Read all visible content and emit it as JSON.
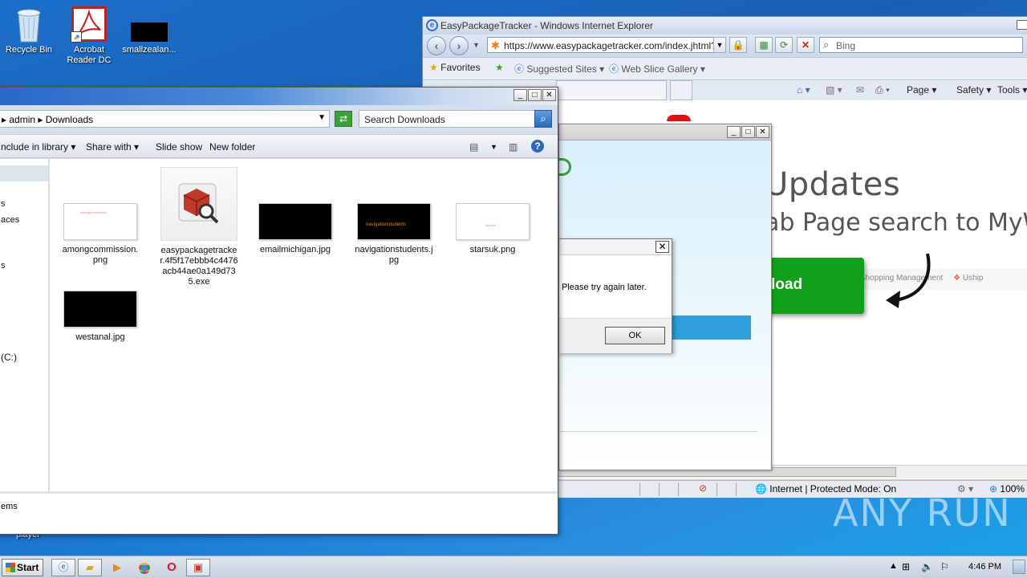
{
  "desktop": {
    "icons": [
      {
        "label": "Recycle Bin",
        "icon": "recycle-bin-icon"
      },
      {
        "label": "Acrobat Reader DC",
        "icon": "acrobat-icon"
      },
      {
        "label": "smallzealan...",
        "icon": "image-file-icon"
      }
    ],
    "partial_label": "player",
    "watermark": "ANY RUN"
  },
  "ie": {
    "title": "EasyPackageTracker - Windows Internet Explorer",
    "address": "https://www.easypackagetracker.com/index.jhtml?pa",
    "search_placeholder": "Bing",
    "favorites": "Favorites",
    "suggested_sites": "Suggested Sites",
    "web_slice_gallery": "Web Slice Gallery",
    "cmd": {
      "page": "Page",
      "safety": "Safety",
      "tools": "Tools"
    },
    "content": {
      "heading": "Updates",
      "subheading": "ab Page search to MyW",
      "download_partial": "load",
      "strip_text": "ge/Shopping Management",
      "strip_uship": "Uship"
    },
    "status": {
      "zone": "Internet | Protected Mode: On",
      "zoom": "100%"
    }
  },
  "error_dialog": {
    "message": "Please try again later.",
    "ok": "OK"
  },
  "explorer": {
    "breadcrumb": {
      "user": "admin",
      "folder": "Downloads"
    },
    "search_placeholder": "Search Downloads",
    "commands": {
      "include": "nclude in library",
      "share": "Share with",
      "slideshow": "Slide show",
      "newfolder": "New folder"
    },
    "nav": {
      "n1": "s",
      "n2": "aces",
      "n3": "s",
      "n4": "(C:)"
    },
    "files": [
      {
        "name": "amongcommission.png",
        "thumb_text": "amongcommission"
      },
      {
        "name": "easypackagetracker.4f5f17ebbb4c4476acb44ae0a149d735.exe",
        "thumb_text": ""
      },
      {
        "name": "emailmichigan.jpg",
        "thumb_text": ""
      },
      {
        "name": "navigationstudents.jpg",
        "thumb_text": "navigationstudents"
      },
      {
        "name": "starsuk.png",
        "thumb_text": "starsuk"
      },
      {
        "name": "westanal.jpg",
        "thumb_text": ""
      }
    ],
    "status": "ems"
  },
  "taskbar": {
    "start": "Start",
    "clock": "4:46 PM"
  }
}
